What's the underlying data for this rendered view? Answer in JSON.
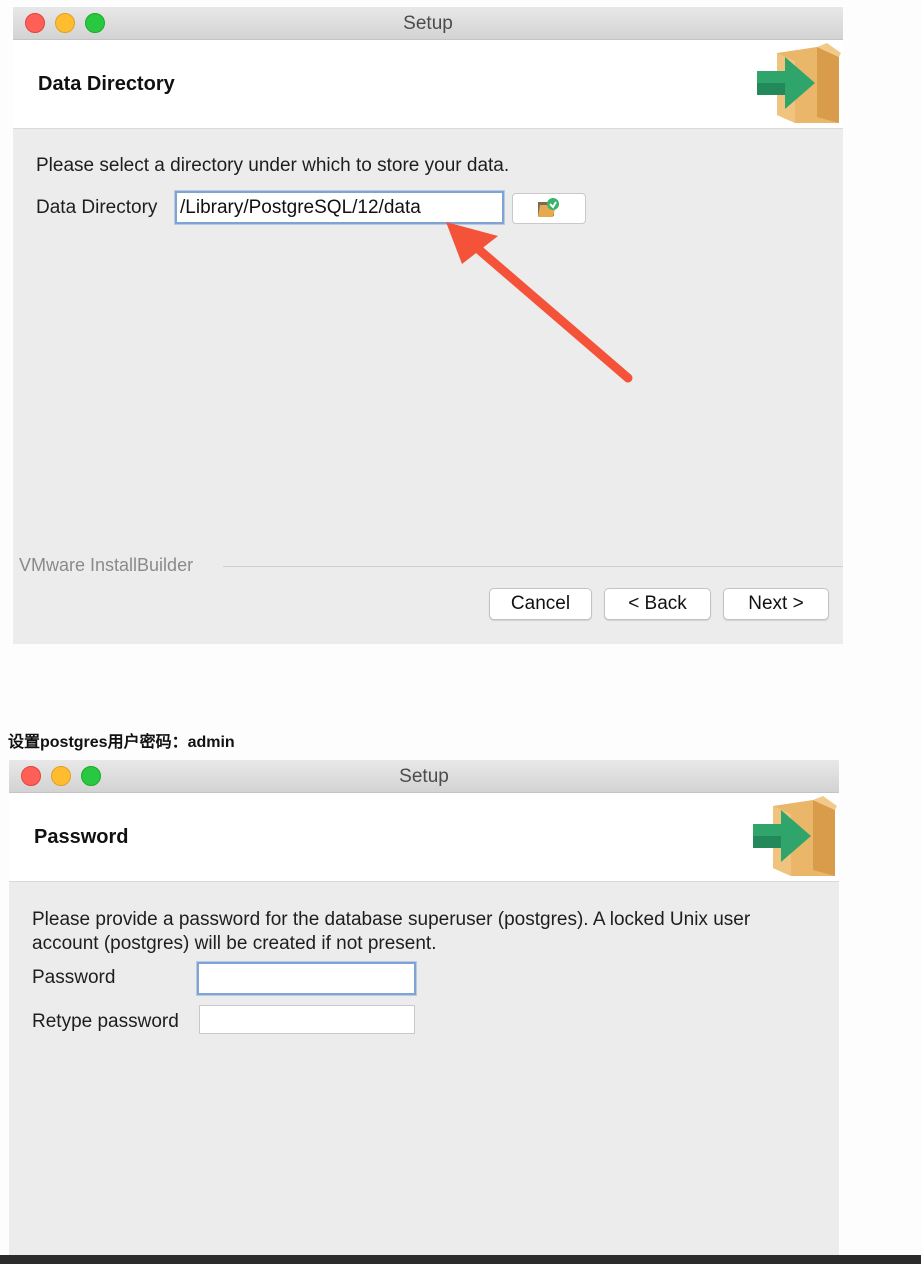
{
  "window1": {
    "title": "Setup",
    "header_title": "Data Directory",
    "instruction": "Please select a directory under which to store your data.",
    "field_label": "Data Directory",
    "field_value": "/Library/PostgreSQL/12/data",
    "browse_icon": "folder-icon",
    "brand": "VMware InstallBuilder",
    "buttons": {
      "cancel": "Cancel",
      "back": "< Back",
      "next": "Next >"
    }
  },
  "caption": "设置postgres用户密码：admin",
  "window2": {
    "title": "Setup",
    "header_title": "Password",
    "instruction_line1": "Please provide a password for the database superuser (postgres). A locked Unix user",
    "instruction_line2": "account (postgres) will be created if not present.",
    "password_label": "Password",
    "password_value": "",
    "retype_label": "Retype password",
    "retype_value": ""
  },
  "colors": {
    "annotation_arrow": "#f4533a",
    "box_brown": "#e9b66a",
    "arrow_green": "#2fa56b",
    "focus_border": "#7fa4d4"
  }
}
